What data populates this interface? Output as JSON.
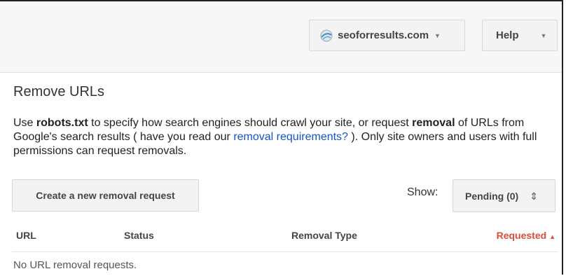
{
  "header": {
    "site_selector": {
      "label": "seoforresults.com",
      "icon": "site-globe-icon"
    },
    "help": {
      "label": "Help"
    }
  },
  "page": {
    "title": "Remove URLs",
    "description": {
      "part1": "Use ",
      "robots": "robots.txt",
      "part2": " to specify how search engines should crawl your site, or request ",
      "removal": "removal",
      "part3": " of URLs from Google's search results ( have you read our ",
      "link": "removal requirements?",
      "part4": " ). Only site owners and users with full permissions can request removals."
    }
  },
  "actions": {
    "create_button": "Create a new removal request",
    "show_label": "Show:",
    "show_value": "Pending (0)"
  },
  "table": {
    "columns": {
      "url": "URL",
      "status": "Status",
      "removal_type": "Removal Type",
      "requested": "Requested"
    },
    "sort_indicator": "▲",
    "empty_message": "No URL removal requests."
  },
  "colors": {
    "link": "#1155cc",
    "sort_active": "#dd4b39"
  }
}
